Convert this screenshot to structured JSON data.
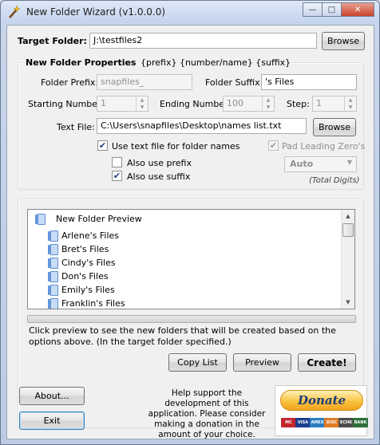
{
  "window": {
    "title": "New Folder Wizard  (v1.0.0.0)"
  },
  "target": {
    "label": "Target Folder:",
    "value": "J:\\testfiles2",
    "browse": "Browse"
  },
  "props": {
    "title": "New Folder Properties",
    "hint": "{prefix} {number/name} {suffix}",
    "prefix_label": "Folder Prefix:",
    "prefix_value": "snapfiles_",
    "suffix_label": "Folder Suffix:",
    "suffix_value": "'s Files",
    "start_label": "Starting Number:",
    "start_value": "1",
    "end_label": "Ending Number:",
    "end_value": "100",
    "step_label": "Step:",
    "step_value": "1",
    "textfile_label": "Text File:",
    "textfile_value": "C:\\Users\\snapfiles\\Desktop\\names list.txt",
    "textfile_browse": "Browse",
    "use_text_label": "Use text file for folder names",
    "use_text_checked": true,
    "pad_label": "Pad Leading Zero's",
    "pad_checked": true,
    "also_prefix_label": "Also use prefix",
    "also_prefix_checked": false,
    "also_suffix_label": "Also use suffix",
    "also_suffix_checked": true,
    "digits_value": "Auto",
    "digits_caption": "(Total Digits)"
  },
  "preview": {
    "header": "New Folder Preview",
    "items": [
      "Arlene's Files",
      "Bret's Files",
      "Cindy's Files",
      "Don's Files",
      "Emily's Files",
      "Franklin's Files"
    ]
  },
  "info_text": "Click preview to see the new folders that will be created based on the options above. (In the target folder specified.)",
  "actions": {
    "copy_list": "Copy List",
    "preview": "Preview",
    "create": "Create!"
  },
  "footer": {
    "about": "About...",
    "exit": "Exit",
    "support_text": "Help support the development of this application. Please consider making a donation in the amount of your choice.",
    "donate": "Donate",
    "cards": [
      "MC",
      "VISA",
      "AMEX",
      "DISC",
      "ECHK",
      "BANK"
    ]
  },
  "colors": {
    "accent": "#3c7fb1",
    "donate": "#f9c03a"
  }
}
